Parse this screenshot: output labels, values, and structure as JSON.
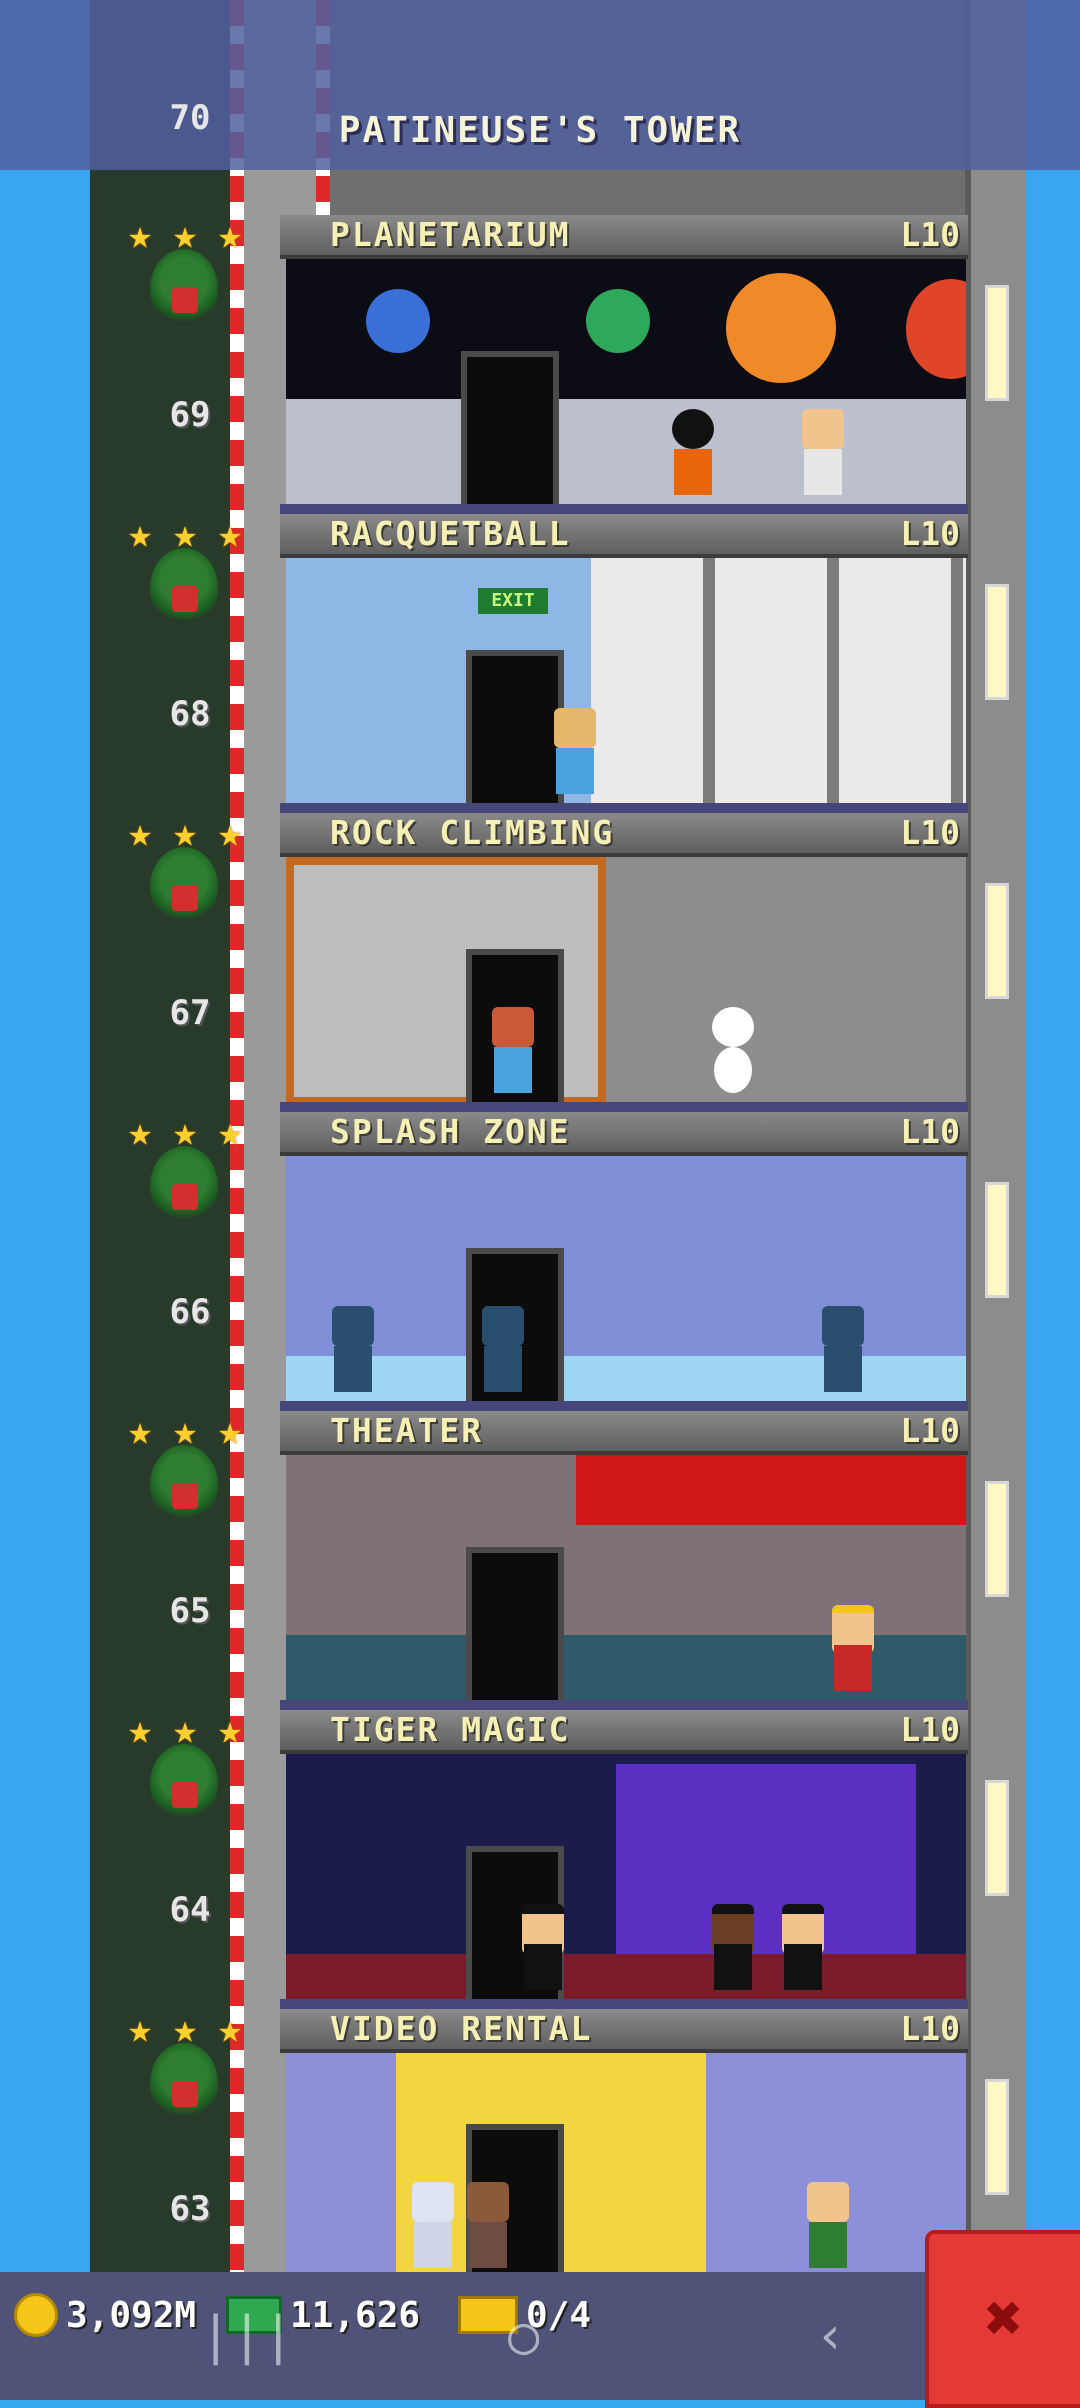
{
  "tower_name": "PATINEUSE'S TOWER",
  "top_floor_number": "70",
  "floors": [
    {
      "name": "PLANETARIUM",
      "level": "L10",
      "number": "69"
    },
    {
      "name": "RACQUETBALL",
      "level": "L10",
      "number": "68"
    },
    {
      "name": "ROCK CLIMBING",
      "level": "L10",
      "number": "67"
    },
    {
      "name": "SPLASH ZONE",
      "level": "L10",
      "number": "66"
    },
    {
      "name": "THEATER",
      "level": "L10",
      "number": "65"
    },
    {
      "name": "TIGER MAGIC",
      "level": "L10",
      "number": "64"
    },
    {
      "name": "VIDEO RENTAL",
      "level": "L10",
      "number": "63"
    }
  ],
  "room_signs": {
    "racquetball_exit": "EXIT"
  },
  "resources": {
    "coins": "3,092M",
    "bux": "11,626",
    "tickets": "0/4"
  },
  "colors": {
    "sky": "#3aa6f2",
    "floor_label": "#f6f0b4",
    "bottom_bar": "#4f5378",
    "action_button": "#e53935"
  },
  "icons": {
    "coin": "coin-icon",
    "bux": "bux-icon",
    "ticket": "ticket-icon",
    "build": "build-tool-icon"
  }
}
